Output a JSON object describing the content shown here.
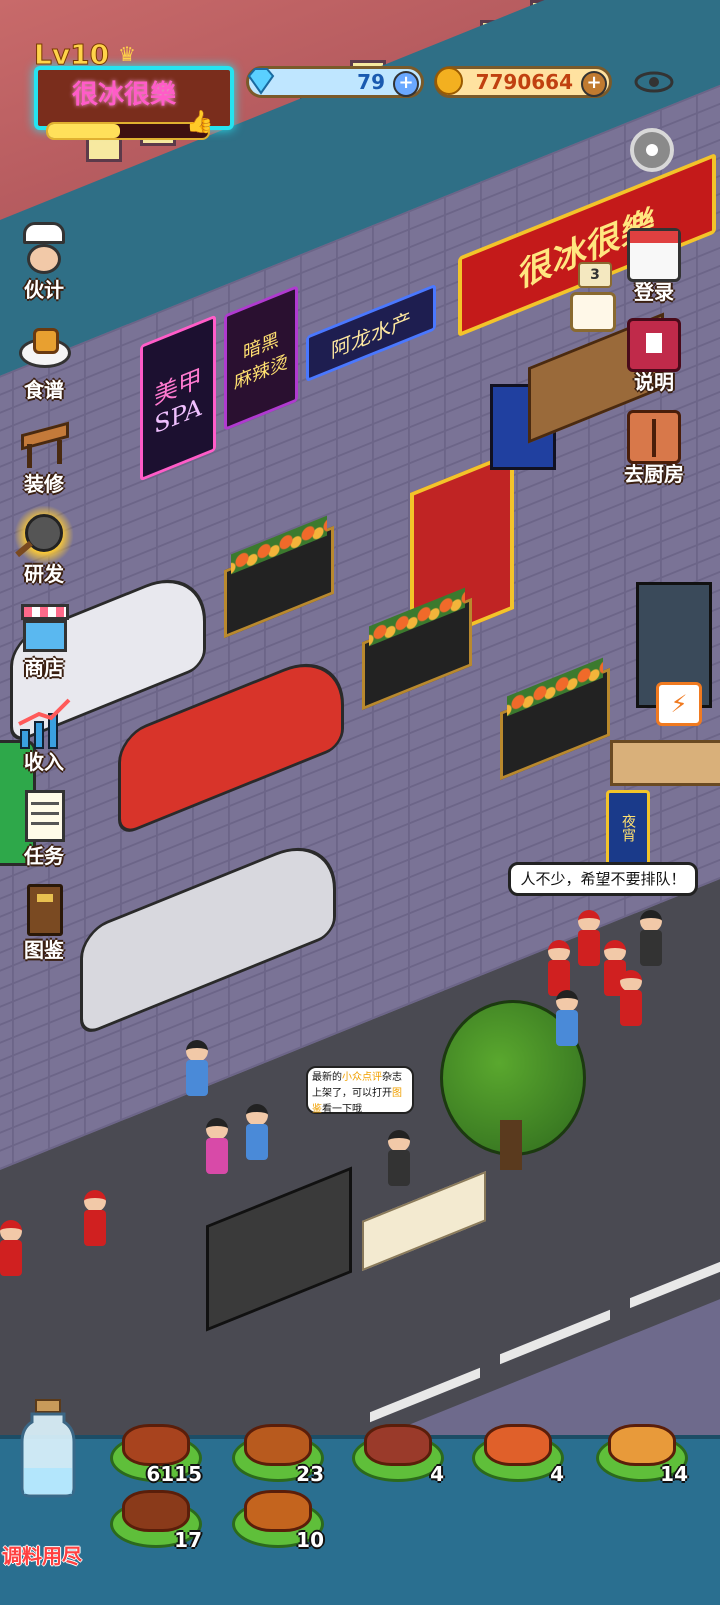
{
  "hud": {
    "level": "Lv10",
    "shop_name": "很冰很樂",
    "xp_fraction": 0.45,
    "diamonds": "79",
    "coins": "7790664",
    "visibility_icon": "eye-icon"
  },
  "left_menu": [
    {
      "id": "staff",
      "label": "伙计",
      "icon": "chef-icon"
    },
    {
      "id": "recipes",
      "label": "食谱",
      "icon": "recipe-plate-icon"
    },
    {
      "id": "decor",
      "label": "装修",
      "icon": "table-icon"
    },
    {
      "id": "research",
      "label": "研发",
      "icon": "frying-pan-icon"
    },
    {
      "id": "store",
      "label": "商店",
      "icon": "shop-icon"
    },
    {
      "id": "income",
      "label": "收入",
      "icon": "growth-chart-icon"
    },
    {
      "id": "tasks",
      "label": "任务",
      "icon": "checklist-icon"
    },
    {
      "id": "codex",
      "label": "图鉴",
      "icon": "book-icon"
    }
  ],
  "right_menu": [
    {
      "id": "login",
      "label": "登录",
      "icon": "calendar-icon",
      "badge": "3"
    },
    {
      "id": "help",
      "label": "说明",
      "icon": "manual-icon"
    },
    {
      "id": "kitchen",
      "label": "去厨房",
      "icon": "kitchen-door-icon"
    }
  ],
  "scene": {
    "neon_signs": [
      "很冰很樂",
      "美甲",
      "SPA",
      "暗黑",
      "麻辣烫",
      "阿龙水产"
    ],
    "night_stall_sign": "夜宵",
    "queue_bubble": "人不少，希望不要排队！",
    "magazine_bubble": {
      "before": "最新的",
      "highlight1": "小众点评",
      "middle": "杂志上架了，可以打开",
      "highlight2": "图鉴",
      "after": "看一下哦"
    },
    "delivery_icon": "delivery-scooter-icon",
    "settings_icon": "gear-icon",
    "colors": {
      "neon_pink": "#ff5cc8",
      "neon_cyan": "#26e3f0",
      "highlight_yellow": "#f0a000",
      "label_red": "#ff4040"
    }
  },
  "tray": {
    "seasoning_label": "调料用尽",
    "items": [
      {
        "name": "kebab-skewers",
        "count": "6115",
        "color": "#a8431e"
      },
      {
        "name": "roast-leg",
        "count": "23",
        "color": "#b85a1e"
      },
      {
        "name": "bacon-strips",
        "count": "4",
        "color": "#9a3a2a"
      },
      {
        "name": "shrimp",
        "count": "4",
        "color": "#e0602a"
      },
      {
        "name": "pancake",
        "count": "14",
        "color": "#e89a3a"
      },
      {
        "name": "roast-chicken",
        "count": "17",
        "color": "#8a3a1a"
      },
      {
        "name": "chicken-wing",
        "count": "10",
        "color": "#c4641e"
      }
    ]
  }
}
